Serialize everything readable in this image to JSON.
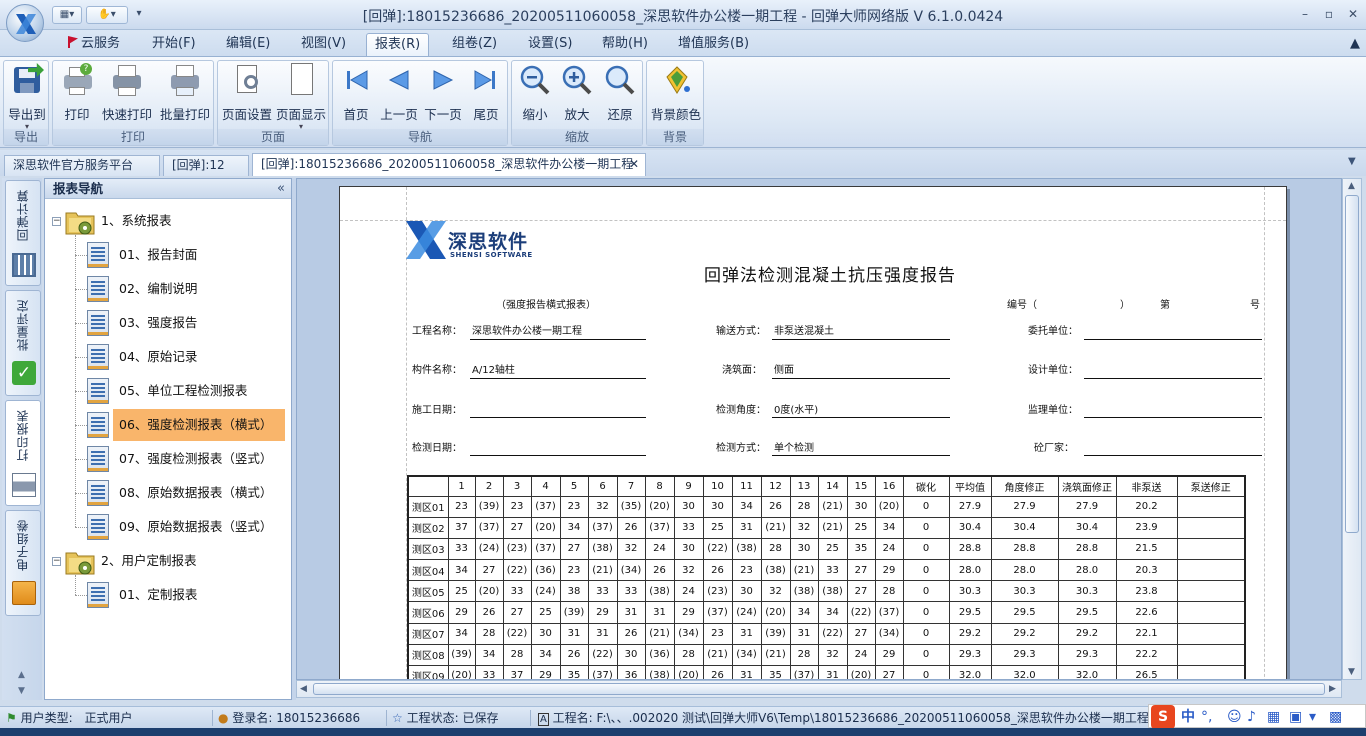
{
  "window": {
    "title": "[回弹]:18015236686_20200511060058_深思软件办公楼一期工程 - 回弹大师网络版 V 6.1.0.0424",
    "qat_more": "▾"
  },
  "menu": {
    "tabs": [
      {
        "label": "云服务"
      },
      {
        "label": "开始(F)"
      },
      {
        "label": "编辑(E)"
      },
      {
        "label": "视图(V)"
      },
      {
        "label": "报表(R)"
      },
      {
        "label": "组卷(Z)"
      },
      {
        "label": "设置(S)"
      },
      {
        "label": "帮助(H)"
      },
      {
        "label": "增值服务(B)"
      }
    ],
    "active": "报表(R)"
  },
  "ribbon": {
    "groups": [
      {
        "label": "导出",
        "buttons": [
          {
            "label": "导出到"
          }
        ]
      },
      {
        "label": "打印",
        "buttons": [
          {
            "label": "打印"
          },
          {
            "label": "快速打印"
          },
          {
            "label": "批量打印"
          }
        ]
      },
      {
        "label": "页面",
        "buttons": [
          {
            "label": "页面设置"
          },
          {
            "label": "页面显示"
          }
        ]
      },
      {
        "label": "导航",
        "buttons": [
          {
            "label": "首页"
          },
          {
            "label": "上一页"
          },
          {
            "label": "下一页"
          },
          {
            "label": "尾页"
          }
        ]
      },
      {
        "label": "缩放",
        "buttons": [
          {
            "label": "缩小"
          },
          {
            "label": "放大"
          },
          {
            "label": "还原"
          }
        ]
      },
      {
        "label": "背景",
        "buttons": [
          {
            "label": "背景颜色"
          }
        ]
      }
    ]
  },
  "doc_tabs": [
    {
      "label": "深思软件官方服务平台"
    },
    {
      "label": "[回弹]:12"
    },
    {
      "label": "[回弹]:18015236686_20200511060058_深思软件办公楼一期工程"
    }
  ],
  "doc_tab_close": "✕",
  "side_tabs": [
    {
      "label": "回弹计算"
    },
    {
      "label": "批量评定"
    },
    {
      "label": "打印报表"
    },
    {
      "label": "电子组卷"
    }
  ],
  "nav": {
    "title": "报表导航",
    "collapse": "«",
    "groups": [
      {
        "label": "1、系统报表",
        "items": [
          {
            "label": "01、报告封面"
          },
          {
            "label": "02、编制说明"
          },
          {
            "label": "03、强度报告"
          },
          {
            "label": "04、原始记录"
          },
          {
            "label": "05、单位工程检测报表"
          },
          {
            "label": "06、强度检测报表（横式）"
          },
          {
            "label": "07、强度检测报表（竖式）"
          },
          {
            "label": "08、原始数据报表（横式）"
          },
          {
            "label": "09、原始数据报表（竖式）"
          }
        ]
      },
      {
        "label": "2、用户定制报表",
        "items": [
          {
            "label": "01、定制报表"
          }
        ]
      }
    ],
    "selected": "06、强度检测报表（横式）"
  },
  "report": {
    "company_name": "深思软件",
    "company_en": "SHENSI SOFTWARE",
    "title": "回弹法检测混凝土抗压强度报告",
    "mode_note": "（强度报告横式报表）",
    "serial_label": "编号（",
    "serial_close": "）",
    "serial_di": "第",
    "serial_hao": "号",
    "fields": {
      "project_label": "工程名称：",
      "project_value": "深思软件办公楼一期工程",
      "transport_label": "输送方式：",
      "transport_value": "非泵送混凝土",
      "client_label": "委托单位：",
      "component_label": "构件名称：",
      "component_value": "A/12轴柱",
      "pour_label": "浇筑面：",
      "pour_value": "侧面",
      "design_label": "设计单位：",
      "construct_date_label": "施工日期：",
      "angle_label": "检测角度：",
      "angle_value": "0度(水平)",
      "supervise_label": "监理单位：",
      "test_date_label": "检测日期：",
      "method_label": "检测方式：",
      "method_value": "单个检测",
      "factory_label": "砼厂家："
    },
    "table": {
      "columns": [
        "",
        "1",
        "2",
        "3",
        "4",
        "5",
        "6",
        "7",
        "8",
        "9",
        "10",
        "11",
        "12",
        "13",
        "14",
        "15",
        "16",
        "碳化",
        "平均值",
        "角度修正",
        "浇筑面修正",
        "非泵送",
        "泵送修正"
      ],
      "rows": [
        [
          "测区01",
          "23",
          "(39)",
          "23",
          "(37)",
          "23",
          "32",
          "(35)",
          "(20)",
          "30",
          "30",
          "34",
          "26",
          "28",
          "(21)",
          "30",
          "(20)",
          "0",
          "27.9",
          "27.9",
          "27.9",
          "20.2",
          ""
        ],
        [
          "测区02",
          "37",
          "(37)",
          "27",
          "(20)",
          "34",
          "(37)",
          "26",
          "(37)",
          "33",
          "25",
          "31",
          "(21)",
          "32",
          "(21)",
          "25",
          "34",
          "0",
          "30.4",
          "30.4",
          "30.4",
          "23.9",
          ""
        ],
        [
          "测区03",
          "33",
          "(24)",
          "(23)",
          "(37)",
          "27",
          "(38)",
          "32",
          "24",
          "30",
          "(22)",
          "(38)",
          "28",
          "30",
          "25",
          "35",
          "24",
          "0",
          "28.8",
          "28.8",
          "28.8",
          "21.5",
          ""
        ],
        [
          "测区04",
          "34",
          "27",
          "(22)",
          "(36)",
          "23",
          "(21)",
          "(34)",
          "26",
          "32",
          "26",
          "23",
          "(38)",
          "(21)",
          "33",
          "27",
          "29",
          "0",
          "28.0",
          "28.0",
          "28.0",
          "20.3",
          ""
        ],
        [
          "测区05",
          "25",
          "(20)",
          "33",
          "(24)",
          "38",
          "33",
          "33",
          "(38)",
          "24",
          "(23)",
          "30",
          "32",
          "(38)",
          "(38)",
          "27",
          "28",
          "0",
          "30.3",
          "30.3",
          "30.3",
          "23.8",
          ""
        ],
        [
          "测区06",
          "29",
          "26",
          "27",
          "25",
          "(39)",
          "29",
          "31",
          "31",
          "29",
          "(37)",
          "(24)",
          "(20)",
          "34",
          "34",
          "(22)",
          "(37)",
          "0",
          "29.5",
          "29.5",
          "29.5",
          "22.6",
          ""
        ],
        [
          "测区07",
          "34",
          "28",
          "(22)",
          "30",
          "31",
          "31",
          "26",
          "(21)",
          "(34)",
          "23",
          "31",
          "(39)",
          "31",
          "(22)",
          "27",
          "(34)",
          "0",
          "29.2",
          "29.2",
          "29.2",
          "22.1",
          ""
        ],
        [
          "测区08",
          "(39)",
          "34",
          "28",
          "34",
          "26",
          "(22)",
          "30",
          "(36)",
          "28",
          "(21)",
          "(34)",
          "(21)",
          "28",
          "32",
          "24",
          "29",
          "0",
          "29.3",
          "29.3",
          "29.3",
          "22.2",
          ""
        ],
        [
          "测区09",
          "(20)",
          "33",
          "37",
          "29",
          "35",
          "(37)",
          "36",
          "(38)",
          "(20)",
          "26",
          "31",
          "35",
          "(37)",
          "31",
          "(20)",
          "27",
          "0",
          "32.0",
          "32.0",
          "32.0",
          "26.5",
          ""
        ]
      ]
    }
  },
  "status": {
    "user_type_label": "用户类型:",
    "user_type_value": "正式用户",
    "login_label": "登录名:",
    "login_value": "18015236686",
    "state_label": "工程状态:",
    "state_value": "已保存",
    "project_label": "工程名:",
    "project_value": "F:\\、、.002020 测试\\回弹大师V6\\Temp\\18015236686_20200511060058_深思软件办公楼一期工程"
  },
  "ime": {
    "lang": "中",
    "punct": "°,"
  }
}
